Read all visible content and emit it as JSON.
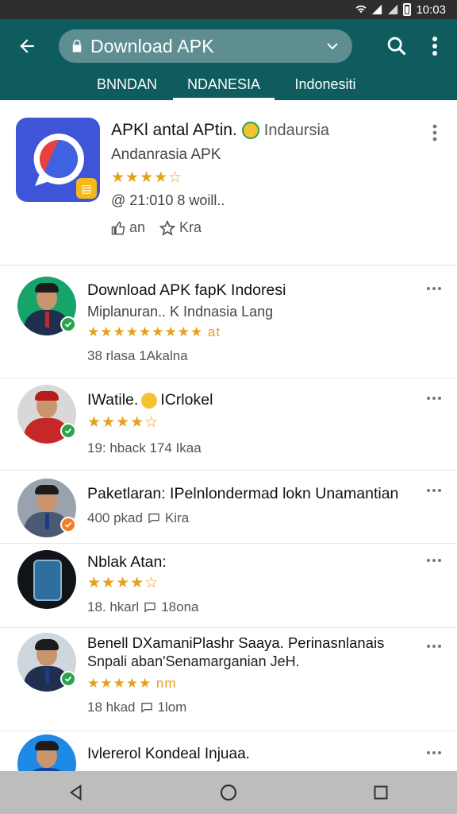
{
  "status_bar": {
    "time": "10:03"
  },
  "app_bar": {
    "title": "Download APK",
    "tabs": [
      {
        "label": "BNNDAN"
      },
      {
        "label": "NDANESIA"
      },
      {
        "label": "Indonesiti"
      }
    ]
  },
  "featured": {
    "title": "APKl antal APtin.",
    "title_suffix": "Indaursia",
    "subtitle": "Andanrasia APK",
    "stars": "★★★★☆",
    "meta": "@ 21:010 8 woill..",
    "action_1": "an",
    "action_2": "Kra"
  },
  "list": [
    {
      "title": "Download APK fapK Indoresi",
      "subtitle": "Miplanuran.. K Indnasia Lang",
      "stars": "★★★★★★★★★ at",
      "meta": "38 rlasa 1Akalna"
    },
    {
      "title": "IWatile.",
      "title_suffix": "ICrlokel",
      "stars": "★★★★☆",
      "meta": "19: hback 174 Ikaa"
    },
    {
      "title": "Paketlaran: IPelnlondermad lokn Unamantian",
      "meta": "400 pkad",
      "meta_suffix": "Kira"
    },
    {
      "title": "Nblak Atan:",
      "stars": "★★★★☆",
      "meta": "18. hkarl",
      "meta_suffix": "18ona"
    },
    {
      "title": "Benell DXamaniPlashr Saaya. Perinasnlanais",
      "subtitle": "Snpali aban'Senamarganian JeH.",
      "stars": "★★★★★ nm",
      "meta": "18 hkad",
      "meta_suffix": "1lom"
    },
    {
      "title": "Ivlererol Kondeal Injuaa."
    }
  ],
  "colors": {
    "app_bar": "#0f5c5e",
    "accent_star": "#e6a11a",
    "verified": "#2aa34a",
    "nav_bar": "#bdbdbd"
  },
  "icons": [
    "wifi-icon",
    "signal-icon",
    "battery-icon",
    "back-arrow-icon",
    "lock-icon",
    "chevron-down-icon",
    "search-icon",
    "more-vert-icon",
    "nav-back-icon",
    "nav-home-icon",
    "nav-recents-icon"
  ]
}
